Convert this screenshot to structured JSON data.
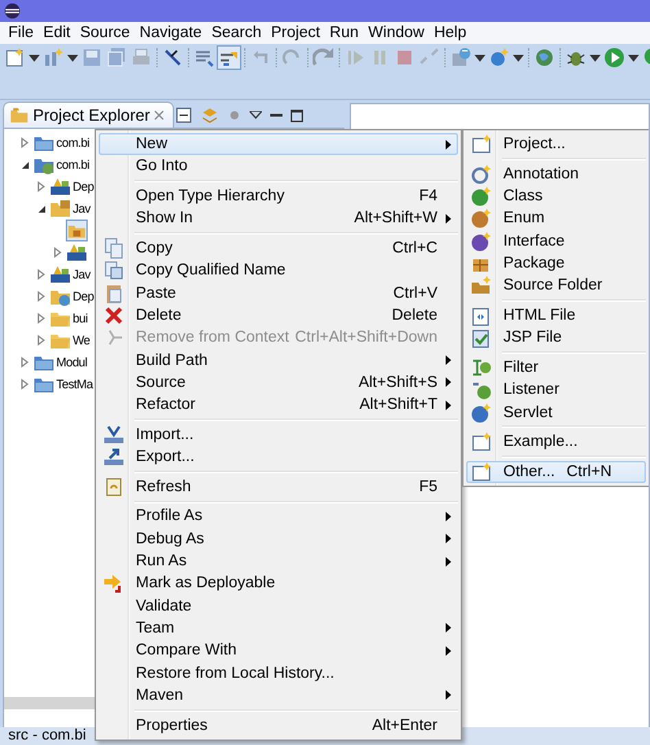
{
  "menu_bar": [
    "File",
    "Edit",
    "Source",
    "Navigate",
    "Search",
    "Project",
    "Run",
    "Window",
    "Help"
  ],
  "toolbar": [
    {
      "kind": "new-file",
      "pressed": false,
      "disabled": false
    },
    {
      "kind": "caret",
      "pressed": false,
      "disabled": false
    },
    {
      "kind": "new-class",
      "pressed": false,
      "disabled": false
    },
    {
      "kind": "caret",
      "pressed": false,
      "disabled": false
    },
    {
      "kind": "save",
      "pressed": false,
      "disabled": true
    },
    {
      "kind": "save-all",
      "pressed": false,
      "disabled": true
    },
    {
      "kind": "print",
      "pressed": false,
      "disabled": true
    },
    {
      "kind": "sep"
    },
    {
      "kind": "pen",
      "pressed": false,
      "disabled": false
    },
    {
      "kind": "sep"
    },
    {
      "kind": "list",
      "pressed": false,
      "disabled": false
    },
    {
      "kind": "toggle",
      "pressed": true,
      "disabled": false
    },
    {
      "kind": "sep"
    },
    {
      "kind": "undo",
      "pressed": false,
      "disabled": true
    },
    {
      "kind": "sep"
    },
    {
      "kind": "redo",
      "pressed": false,
      "disabled": true
    },
    {
      "kind": "sep"
    },
    {
      "kind": "step",
      "pressed": false,
      "disabled": true
    },
    {
      "kind": "sep"
    },
    {
      "kind": "resume",
      "pressed": false,
      "disabled": true
    },
    {
      "kind": "pause",
      "pressed": false,
      "disabled": true
    },
    {
      "kind": "stop",
      "pressed": false,
      "disabled": true
    },
    {
      "kind": "disconnect",
      "pressed": false,
      "disabled": true
    },
    {
      "kind": "sep"
    },
    {
      "kind": "server",
      "pressed": false,
      "disabled": false
    },
    {
      "kind": "caret",
      "pressed": false,
      "disabled": false
    },
    {
      "kind": "web",
      "pressed": false,
      "disabled": false
    },
    {
      "kind": "caret",
      "pressed": false,
      "disabled": false
    },
    {
      "kind": "sep"
    },
    {
      "kind": "globe",
      "pressed": false,
      "disabled": false
    },
    {
      "kind": "sep"
    },
    {
      "kind": "debug",
      "pressed": false,
      "disabled": false
    },
    {
      "kind": "caret",
      "pressed": false,
      "disabled": false
    },
    {
      "kind": "run",
      "pressed": false,
      "disabled": false
    },
    {
      "kind": "caret",
      "pressed": false,
      "disabled": false
    },
    {
      "kind": "run-ext",
      "pressed": false,
      "disabled": false
    }
  ],
  "view_tab": {
    "label": "Project Explorer",
    "selected": true
  },
  "tree": [
    {
      "kind": "project",
      "label": "com.bi",
      "expanded": false,
      "selected": false
    },
    {
      "kind": "web-project",
      "label": "com.bi",
      "expanded": true,
      "selected": false,
      "children": [
        {
          "kind": "library",
          "label": "Dep",
          "expanded": false,
          "selected": false
        },
        {
          "kind": "source-folder",
          "label": "Jav",
          "expanded": true,
          "selected": false,
          "children": [
            {
              "kind": "package",
              "selected": true
            },
            {
              "kind": "library",
              "expanded": false,
              "selected": false
            }
          ]
        },
        {
          "kind": "library",
          "label": "Jav",
          "expanded": false,
          "selected": false
        },
        {
          "kind": "web-folder",
          "label": "Dep",
          "expanded": false,
          "selected": false
        },
        {
          "kind": "folder",
          "label": "bui",
          "expanded": false,
          "selected": false
        },
        {
          "kind": "folder",
          "label": "We",
          "expanded": false,
          "selected": false
        }
      ]
    },
    {
      "kind": "project",
      "label": "Modul",
      "expanded": false,
      "selected": false
    },
    {
      "kind": "project",
      "label": "TestMa",
      "expanded": false,
      "selected": false
    }
  ],
  "context_menu": [
    {
      "kind": "item",
      "label": "New",
      "submenu": true,
      "selected": true,
      "disabled": false
    },
    {
      "kind": "item",
      "label": "Go Into",
      "submenu": false,
      "selected": false,
      "disabled": false
    },
    {
      "kind": "separator"
    },
    {
      "kind": "item",
      "label": "Open Type Hierarchy",
      "shortcut": "F4",
      "submenu": false,
      "selected": false,
      "disabled": false
    },
    {
      "kind": "item",
      "label": "Show In",
      "shortcut": "Alt+Shift+W",
      "submenu": true,
      "selected": false,
      "disabled": false
    },
    {
      "kind": "separator"
    },
    {
      "kind": "item",
      "label": "Copy",
      "shortcut": "Ctrl+C",
      "submenu": false,
      "selected": false,
      "disabled": false
    },
    {
      "kind": "item",
      "label": "Copy Qualified Name",
      "submenu": false,
      "selected": false,
      "disabled": false
    },
    {
      "kind": "item",
      "label": "Paste",
      "shortcut": "Ctrl+V",
      "submenu": false,
      "selected": false,
      "disabled": false
    },
    {
      "kind": "item",
      "label": "Delete",
      "shortcut": "Delete",
      "submenu": false,
      "selected": false,
      "disabled": false
    },
    {
      "kind": "item",
      "label": "Remove from Context",
      "shortcut": "Ctrl+Alt+Shift+Down",
      "submenu": false,
      "selected": false,
      "disabled": true
    },
    {
      "kind": "item",
      "label": "Build Path",
      "submenu": true,
      "selected": false,
      "disabled": false
    },
    {
      "kind": "item",
      "label": "Source",
      "shortcut": "Alt+Shift+S",
      "submenu": true,
      "selected": false,
      "disabled": false
    },
    {
      "kind": "item",
      "label": "Refactor",
      "shortcut": "Alt+Shift+T",
      "submenu": true,
      "selected": false,
      "disabled": false
    },
    {
      "kind": "separator"
    },
    {
      "kind": "item",
      "label": "Import...",
      "submenu": false,
      "selected": false,
      "disabled": false
    },
    {
      "kind": "item",
      "label": "Export...",
      "submenu": false,
      "selected": false,
      "disabled": false
    },
    {
      "kind": "separator"
    },
    {
      "kind": "item",
      "label": "Refresh",
      "shortcut": "F5",
      "submenu": false,
      "selected": false,
      "disabled": false
    },
    {
      "kind": "separator"
    },
    {
      "kind": "item",
      "label": "Profile As",
      "submenu": true,
      "selected": false,
      "disabled": false
    },
    {
      "kind": "item",
      "label": "Debug As",
      "submenu": true,
      "selected": false,
      "disabled": false
    },
    {
      "kind": "item",
      "label": "Run As",
      "submenu": true,
      "selected": false,
      "disabled": false
    },
    {
      "kind": "item",
      "label": "Mark as Deployable",
      "submenu": false,
      "selected": false,
      "disabled": false
    },
    {
      "kind": "item",
      "label": "Validate",
      "submenu": false,
      "selected": false,
      "disabled": false
    },
    {
      "kind": "item",
      "label": "Team",
      "submenu": true,
      "selected": false,
      "disabled": false
    },
    {
      "kind": "item",
      "label": "Compare With",
      "submenu": true,
      "selected": false,
      "disabled": false
    },
    {
      "kind": "item",
      "label": "Restore from Local History...",
      "submenu": false,
      "selected": false,
      "disabled": false
    },
    {
      "kind": "item",
      "label": "Maven",
      "submenu": true,
      "selected": false,
      "disabled": false
    },
    {
      "kind": "separator"
    },
    {
      "kind": "item",
      "label": "Properties",
      "shortcut": "Alt+Enter",
      "submenu": false,
      "selected": false,
      "disabled": false
    }
  ],
  "new_submenu": [
    {
      "kind": "item",
      "label": "Project...",
      "selected": false
    },
    {
      "kind": "separator"
    },
    {
      "kind": "item",
      "label": "Annotation",
      "selected": false
    },
    {
      "kind": "item",
      "label": "Class",
      "selected": false
    },
    {
      "kind": "item",
      "label": "Enum",
      "selected": false
    },
    {
      "kind": "item",
      "label": "Interface",
      "selected": false
    },
    {
      "kind": "item",
      "label": "Package",
      "selected": false
    },
    {
      "kind": "item",
      "label": "Source Folder",
      "selected": false
    },
    {
      "kind": "separator"
    },
    {
      "kind": "item",
      "label": "HTML File",
      "selected": false
    },
    {
      "kind": "item",
      "label": "JSP File",
      "selected": false
    },
    {
      "kind": "separator"
    },
    {
      "kind": "item",
      "label": "Filter",
      "selected": false
    },
    {
      "kind": "item",
      "label": "Listener",
      "selected": false
    },
    {
      "kind": "item",
      "label": "Servlet",
      "selected": false
    },
    {
      "kind": "separator"
    },
    {
      "kind": "item",
      "label": "Example...",
      "selected": false
    },
    {
      "kind": "separator"
    },
    {
      "kind": "item",
      "label": "Other...",
      "shortcut": "Ctrl+N",
      "selected": true
    }
  ],
  "status_bar": {
    "text": "src - com.bi"
  }
}
